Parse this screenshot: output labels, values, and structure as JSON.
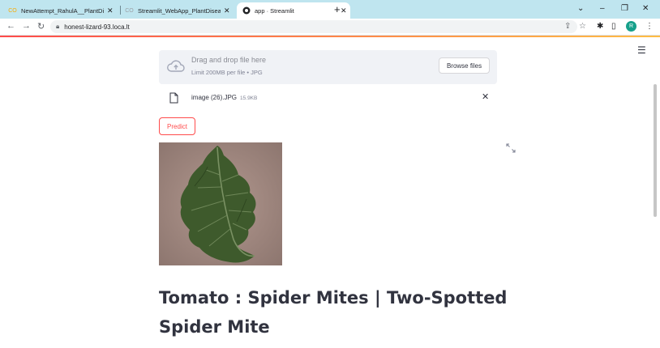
{
  "browser": {
    "tabs": [
      {
        "title": "NewAttempt_RahulA__PlantDisea",
        "favicon": "colab-icon"
      },
      {
        "title": "Streamlit_WebApp_PlantDisease",
        "favicon": "colab-icon"
      },
      {
        "title": "app · Streamlit",
        "favicon": "streamlit-icon"
      }
    ],
    "url": "honest-lizard-93.loca.lt",
    "profile_initial": "R"
  },
  "uploader": {
    "dropzone_title": "Drag and drop file here",
    "dropzone_limit": "Limit 200MB per file • JPG",
    "browse_label": "Browse files",
    "file_name": "image (26).JPG",
    "file_size": "15.9KB"
  },
  "predict_label": "Predict",
  "result_text": "Tomato : Spider Mites | Two-Spotted Spider Mite",
  "colors": {
    "accent": "#ff4b4b",
    "tab_strip": "#bfe5ef",
    "text": "#31333f"
  }
}
